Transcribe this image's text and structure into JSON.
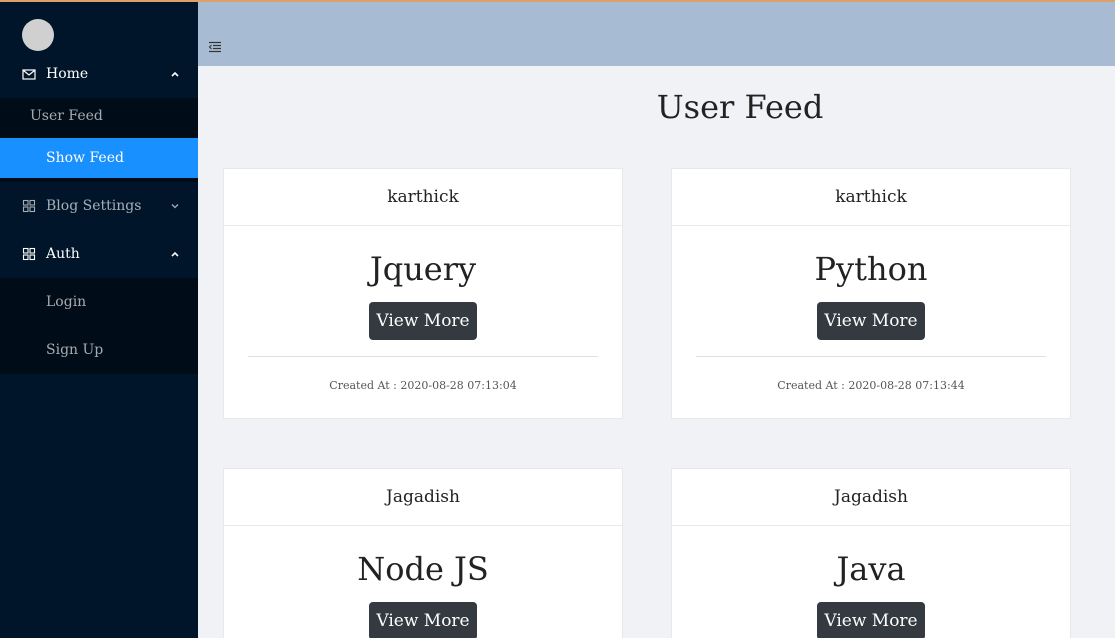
{
  "sidebar": {
    "menu": [
      {
        "label": "Home",
        "icon": "mail-icon",
        "expanded": true,
        "children": [
          {
            "label": "User Feed",
            "active": false
          },
          {
            "label": "Show Feed",
            "active": true
          }
        ]
      },
      {
        "label": "Blog Settings",
        "icon": "appstore-icon",
        "expanded": false,
        "children": []
      },
      {
        "label": "Auth",
        "icon": "appstore-icon",
        "expanded": true,
        "children": [
          {
            "label": "Login",
            "active": false
          },
          {
            "label": "Sign Up",
            "active": false
          }
        ]
      }
    ]
  },
  "page": {
    "title": "User Feed"
  },
  "cards": [
    {
      "author": "karthick",
      "title": "Jquery",
      "button": "View More",
      "created": "Created At : 2020-08-28 07:13:04"
    },
    {
      "author": "karthick",
      "title": "Python",
      "button": "View More",
      "created": "Created At : 2020-08-28 07:13:44"
    },
    {
      "author": "Jagadish",
      "title": "Node JS",
      "button": "View More"
    },
    {
      "author": "Jagadish",
      "title": "Java",
      "button": "View More"
    }
  ],
  "colors": {
    "sidebar_bg": "#001529",
    "submenu_bg": "#000c17",
    "active_item": "#1890ff",
    "header_bg": "#a7bcd3",
    "button_bg": "#343a40"
  }
}
